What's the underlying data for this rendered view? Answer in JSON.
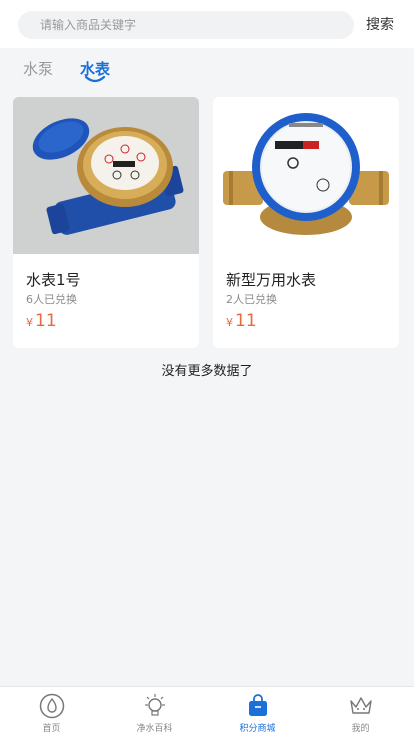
{
  "search": {
    "placeholder": "请输入商品关键字",
    "button_label": "搜索"
  },
  "tabs": [
    {
      "label": "水泵",
      "active": false
    },
    {
      "label": "水表",
      "active": true
    }
  ],
  "products": [
    {
      "title": "水表1号",
      "redeemed": "6人已兑换",
      "currency": "¥",
      "price": "11"
    },
    {
      "title": "新型万用水表",
      "redeemed": "2人已兑换",
      "currency": "¥",
      "price": "11"
    }
  ],
  "list_end_text": "没有更多数据了",
  "bottom_nav": [
    {
      "label": "首页",
      "icon": "drop-icon",
      "active": false
    },
    {
      "label": "净水百科",
      "icon": "bulb-icon",
      "active": false
    },
    {
      "label": "积分商城",
      "icon": "bag-icon",
      "active": true
    },
    {
      "label": "我的",
      "icon": "crown-icon",
      "active": false
    }
  ],
  "colors": {
    "accent": "#1a6fd8",
    "price": "#e86a3f",
    "background": "#f4f5f7"
  }
}
